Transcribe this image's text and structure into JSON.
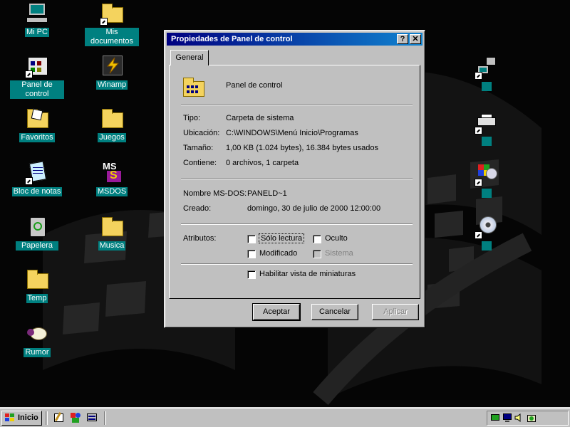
{
  "colors": {
    "desktop": "#050505",
    "label_bg": "#008080",
    "titlebar_start": "#000080",
    "titlebar_end": "#1084d0",
    "face": "#c0c0c0"
  },
  "desktop_icons": [
    {
      "name": "Mi PC",
      "icon": "computer-icon"
    },
    {
      "name": "Mis documentos",
      "icon": "folder-icon"
    },
    {
      "name": "Panel de control",
      "icon": "control-panel-icon"
    },
    {
      "name": "Winamp",
      "icon": "lightning-icon"
    },
    {
      "name": "Favoritos",
      "icon": "open-folder-icon"
    },
    {
      "name": "Juegos",
      "icon": "folder-icon"
    },
    {
      "name": "Bloc de notas",
      "icon": "notepad-icon"
    },
    {
      "name": "MSDOS",
      "icon": "ms-dos-icon"
    },
    {
      "name": "Papelera",
      "icon": "recycle-bin-icon"
    },
    {
      "name": "Musica",
      "icon": "folder-icon"
    },
    {
      "name": "Temp",
      "icon": "folder-icon"
    },
    {
      "name": "Rumor",
      "icon": "sheep-icon"
    },
    {
      "name": "",
      "icon": "network-computer-icon"
    },
    {
      "name": "",
      "icon": "printer-icon"
    },
    {
      "name": "",
      "icon": "multimedia-icon"
    },
    {
      "name": "",
      "icon": "cd-rom-icon"
    }
  ],
  "dialog": {
    "title": "Propiedades de Panel de control",
    "tab_general": "General",
    "folder_name": "Panel de control",
    "labels": {
      "type": "Tipo:",
      "location": "Ubicación:",
      "size": "Tamaño:",
      "contains": "Contiene:",
      "msdos_name": "Nombre MS-DOS:",
      "created": "Creado:",
      "attributes": "Atributos:"
    },
    "values": {
      "type": "Carpeta de sistema",
      "location": "C:\\WINDOWS\\Menú Inicio\\Programas",
      "size": "1,00 KB (1.024 bytes), 16.384 bytes usados",
      "contains": "0 archivos, 1 carpeta",
      "msdos_name": "PANELD~1",
      "created": "domingo, 30 de julio de 2000 12:00:00"
    },
    "attributes": {
      "read_only": "Sólo lectura",
      "hidden": "Oculto",
      "archive": "Modificado",
      "system": "Sistema",
      "thumbnail": "Habilitar vista de miniaturas"
    },
    "buttons": {
      "ok": "Aceptar",
      "cancel": "Cancelar",
      "apply": "Aplicar"
    },
    "help_symbol": "?",
    "close_symbol": "✕"
  },
  "taskbar": {
    "start_label": "Inicio",
    "quick_launch": [
      "paint-icon",
      "shapes-icon",
      "tasks-icon"
    ],
    "tray_icons": [
      "network-icon",
      "monitor-icon",
      "speaker-icon",
      "scheduler-icon"
    ]
  }
}
